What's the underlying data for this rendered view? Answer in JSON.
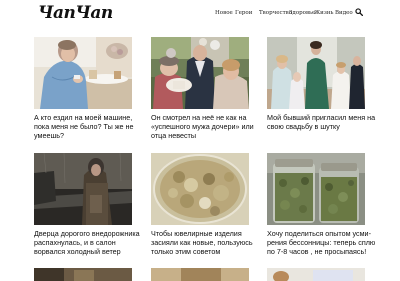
{
  "header": {
    "logo": "ЧапЧап",
    "nav": [
      "Новое",
      "Герои",
      "Творчество",
      "Здоровье",
      "Жизнь",
      "Видео"
    ]
  },
  "cards": [
    {
      "title_lines": [
        "А кто ездил на моей машине,",
        "пока меня не было? Ты же не",
        "умеешь?"
      ]
    },
    {
      "title_lines": [
        "Он смотрел на неё не как на",
        "«успешного мужа дочери» или",
        "отца невесты"
      ]
    },
    {
      "title_lines": [
        "Мой бывший пригласил меня на",
        "свою свадьбу в шутку"
      ]
    },
    {
      "title_lines": [
        "Дверца дорогого внедорожника",
        "распахнулась, и в салон",
        "ворвался холодный ветер"
      ]
    },
    {
      "title_lines": [
        "Чтобы ювелирные изделия",
        "засияли как новые, пользуюсь",
        "только этим советом"
      ]
    },
    {
      "title_lines": [
        "Хочу поделиться опытом усми-",
        "рения бессонницы: теперь сплю",
        "по 7-8 часов , не просыпаясь!"
      ]
    }
  ],
  "colors": {
    "background": "#ffffff",
    "text": "#111111"
  }
}
